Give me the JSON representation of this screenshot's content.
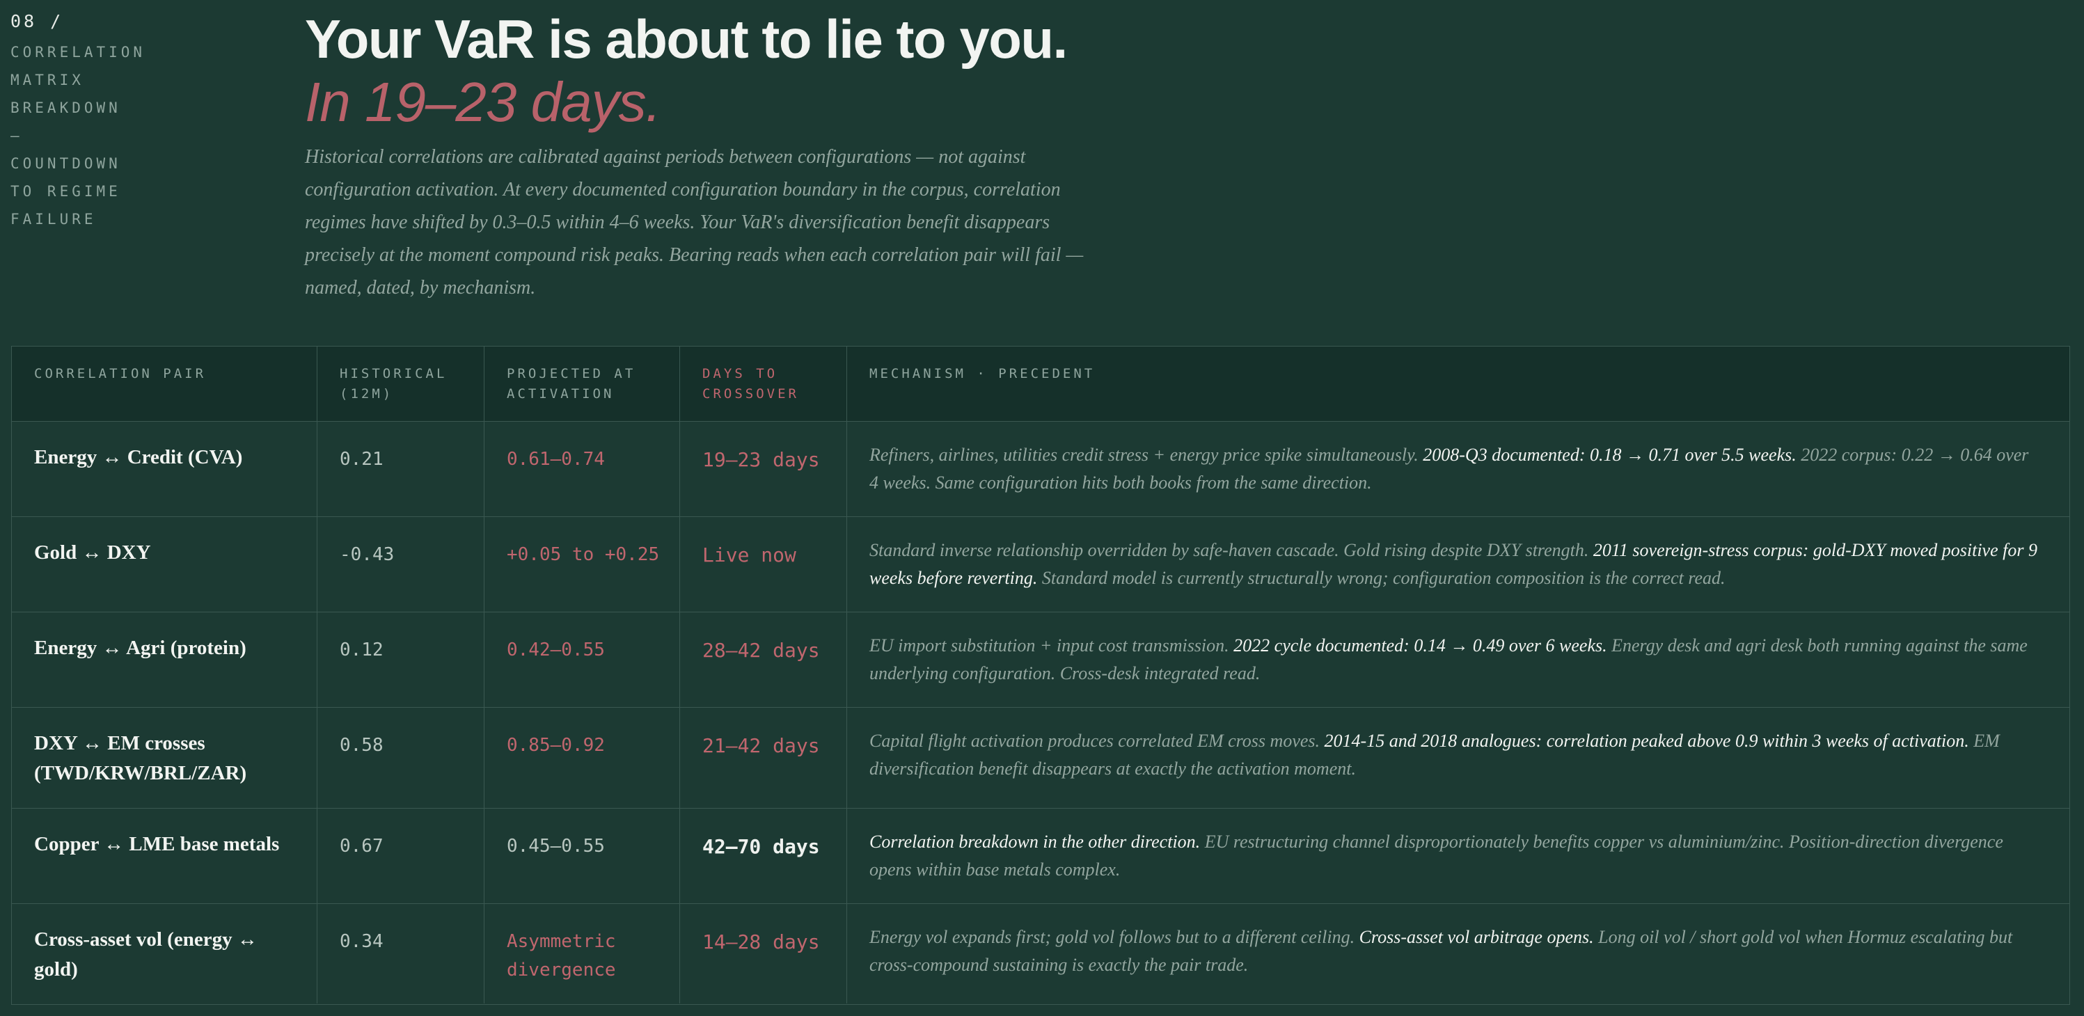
{
  "section": {
    "number": "08 /",
    "label_lines": [
      "CORRELATION",
      "MATRIX",
      "BREAKDOWN",
      "—",
      "COUNTDOWN",
      "TO REGIME",
      "FAILURE"
    ]
  },
  "hero": {
    "headline": "Your VaR is about to lie to you.",
    "subhead": "In 19–23 days.",
    "lede": "Historical correlations are calibrated against periods between configurations — not against configuration activation. At every documented configuration boundary in the corpus, correlation regimes have shifted by 0.3–0.5 within 4–6 weeks. Your VaR's diversification benefit disappears precisely at the moment compound risk peaks. Bearing reads when each correlation pair will fail — named, dated, by mechanism."
  },
  "table": {
    "headers": {
      "pair": "CORRELATION PAIR",
      "historical": "HISTORICAL (12M)",
      "projected": "PROJECTED AT ACTIVATION",
      "days": "DAYS TO CROSSOVER",
      "mechanism": "MECHANISM · PRECEDENT"
    },
    "rows": [
      {
        "pair": "Energy ↔ Credit (CVA)",
        "historical": "0.21",
        "projected": "0.61–0.74",
        "days": "19–23 days",
        "mech_a": "Refiners, airlines, utilities credit stress + energy price spike simultaneously. ",
        "mech_b": "2008-Q3 documented: 0.18 → 0.71 over 5.5 weeks.",
        "mech_c": " 2022 corpus: 0.22 → 0.64 over 4 weeks. Same configuration hits both books from the same direction."
      },
      {
        "pair": "Gold ↔ DXY",
        "historical": "-0.43",
        "projected": "+0.05 to +0.25",
        "days": "Live now",
        "mech_a": "Standard inverse relationship overridden by safe-haven cascade. Gold rising despite DXY strength. ",
        "mech_b": "2011 sovereign-stress corpus: gold-DXY moved positive for 9 weeks before reverting.",
        "mech_c": " Standard model is currently structurally wrong; configuration composition is the correct read."
      },
      {
        "pair": "Energy ↔ Agri (protein)",
        "historical": "0.12",
        "projected": "0.42–0.55",
        "days": "28–42 days",
        "mech_a": "EU import substitution + input cost transmission. ",
        "mech_b": "2022 cycle documented: 0.14 → 0.49 over 6 weeks.",
        "mech_c": " Energy desk and agri desk both running against the same underlying configuration. Cross-desk integrated read."
      },
      {
        "pair": "DXY ↔ EM crosses (TWD/KRW/BRL/ZAR)",
        "historical": "0.58",
        "projected": "0.85–0.92",
        "days": "21–42 days",
        "mech_a": "Capital flight activation produces correlated EM cross moves. ",
        "mech_b": "2014-15 and 2018 analogues: correlation peaked above 0.9 within 3 weeks of activation.",
        "mech_c": " EM diversification benefit disappears at exactly the activation moment."
      },
      {
        "pair": "Copper ↔ LME base metals",
        "historical": "0.67",
        "projected": "0.45–0.55",
        "days": "42–70 days",
        "mech_a": "",
        "mech_b": "Correlation breakdown in the other direction.",
        "mech_c": " EU restructuring channel disproportionately benefits copper vs aluminium/zinc. Position-direction divergence opens within base metals complex."
      },
      {
        "pair": "Cross-asset vol (energy ↔ gold)",
        "historical": "0.34",
        "projected": "Asymmetric divergence",
        "days": "14–28 days",
        "mech_a": "Energy vol expands first; gold vol follows but to a different ceiling. ",
        "mech_b": "Cross-asset vol arbitrage opens.",
        "mech_c": " Long oil vol / short gold vol when Hormuz escalating but cross-compound sustaining is exactly the pair trade."
      }
    ]
  }
}
